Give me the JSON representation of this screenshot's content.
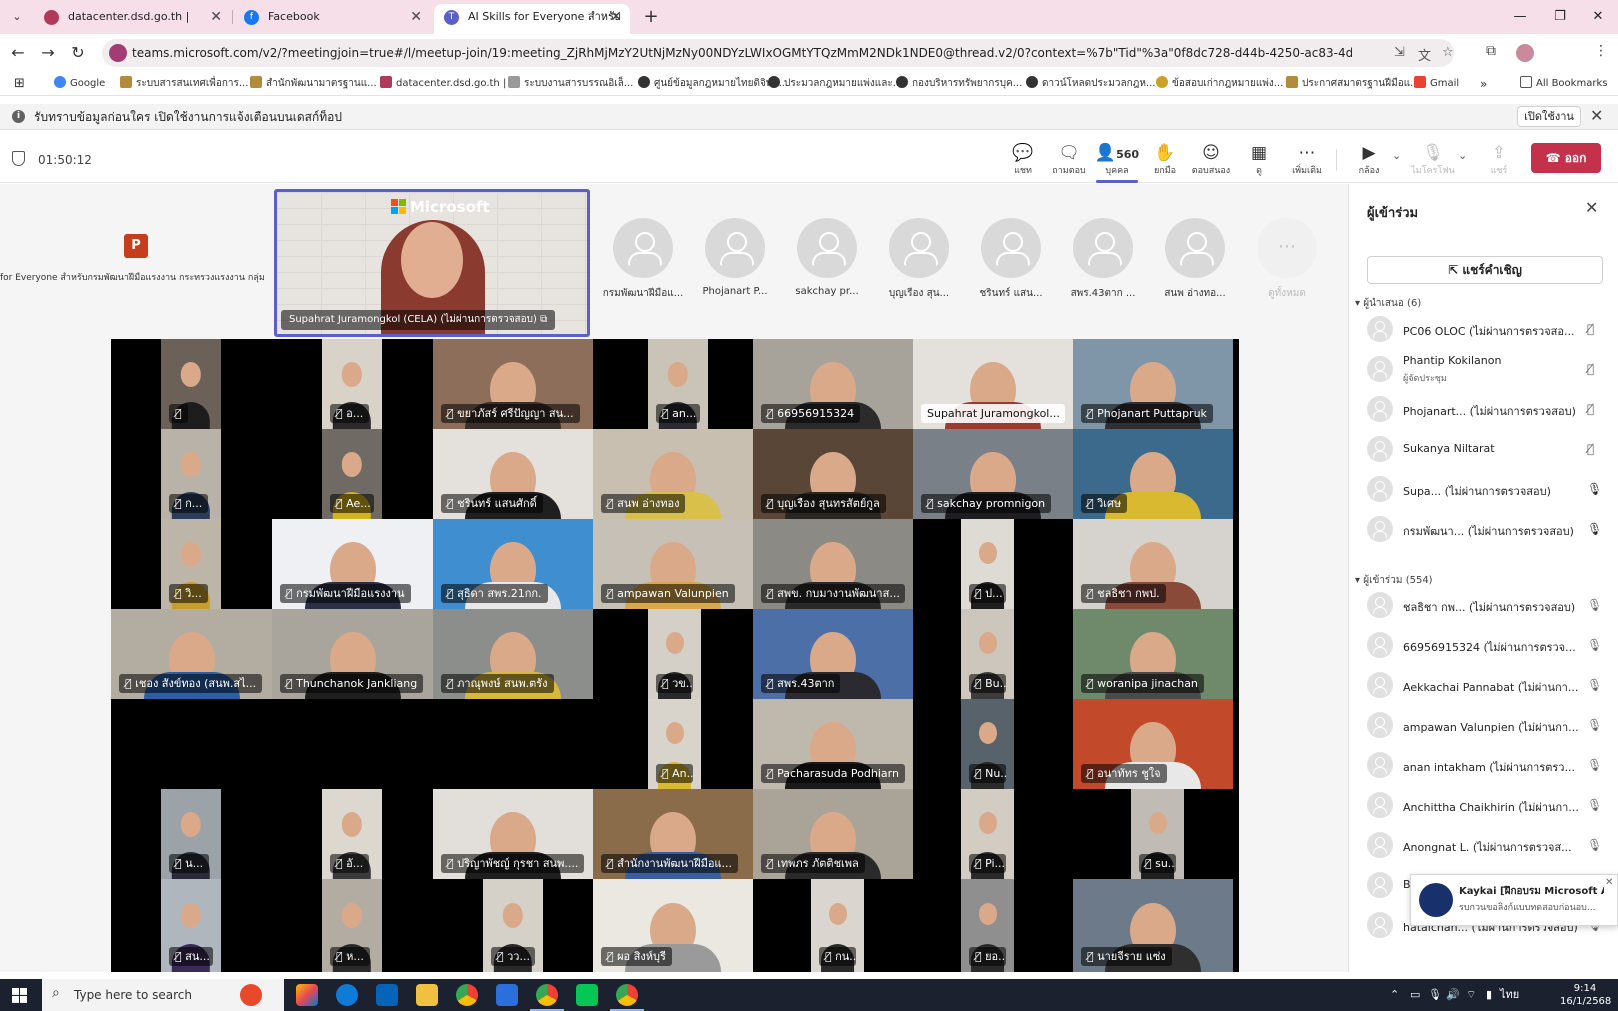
{
  "browser": {
    "tabs": [
      {
        "title": "datacenter.dsd.go.th |",
        "fav_color": "#b03a5b",
        "active": false
      },
      {
        "title": "Facebook",
        "fav_color": "#1877f2",
        "active": false
      },
      {
        "title": "AI Skills for Everyone สำหรับ",
        "fav_color": "#5b5fc7",
        "active": true
      }
    ],
    "new_tab": "+",
    "url": "teams.microsoft.com/v2/?meetingjoin=true#/l/meetup-join/19:meeting_ZjRhMjMzY2UtNjMzNy00NDYzLWIxOGMtYTQzMmM2NDk1NDE0@thread.v2/0?context=%7b\"Tid\"%3a\"0f8dc728-d44b-4250-ac83-4dfe317d4250\"%2c\"Oid\"%3a\"92b...",
    "bookmarks": [
      {
        "label": "Google",
        "color": "#4285f4"
      },
      {
        "label": "ระบบสารสนเทศเพื่อการ...",
        "color": "#b38b3c"
      },
      {
        "label": "สำนักพัฒนามาตรฐานแ...",
        "color": "#b38b3c"
      },
      {
        "label": "datacenter.dsd.go.th |",
        "color": "#b03a5b"
      },
      {
        "label": "ระบบงานสารบรรณอิเล็...",
        "color": "#9a9a9a"
      },
      {
        "label": "ศูนย์ข้อมูลกฎหมายไทยดิจิทัล...",
        "color": "#333333"
      },
      {
        "label": "ประมวลกฎหมายแพ่งและ...",
        "color": "#333333"
      },
      {
        "label": "กองบริหารทรัพยากรบุค...",
        "color": "#333333"
      },
      {
        "label": "ดาวน์โหลดประมวลกฎห...",
        "color": "#333333"
      },
      {
        "label": "ข้อสอบเก่ากฎหมายแพ่ง...",
        "color": "#c9a227"
      },
      {
        "label": "ประกาศสมาตรฐานฝีมือแ...",
        "color": "#b38b3c"
      },
      {
        "label": "Gmail",
        "color": "#ea4335"
      }
    ],
    "all_bookmarks": "All Bookmarks"
  },
  "infobar": {
    "text": "รับทราบข้อมูลก่อนใคร เปิดใช้งานการแจ้งเตือนบนเดสก์ท็อป",
    "enable_button": "เปิดใช้งาน"
  },
  "meeting": {
    "timer": "01:50:12",
    "controls": {
      "chat": "แชท",
      "qa": "ถามตอบ",
      "people": "บุคคล",
      "people_count": "560",
      "raise": "ยกมือ",
      "react": "ตอบสนอง",
      "view": "ดู",
      "more": "เพิ่มเติม",
      "camera": "กล้อง",
      "mic": "ไมโครโฟน",
      "share": "แชร์",
      "leave": "ออก"
    },
    "share_title": "for Everyone สำหรับกรมพัฒนาฝีมือแรงงาน กระทรวงแรงงาน กลุ่ม",
    "ppt_glyph": "P",
    "spotlight_brand": "Microsoft",
    "spotlight_name": "Supahrat Juramongkol (CELA) (ไม่ผ่านการตรวจสอบ)",
    "top_row": [
      "กรมพัฒนาฝีมือแ...",
      "Phojanart P...",
      "sakchay pr...",
      "บุญเรือง สุน...",
      "ชรินทร์ แสน...",
      "สพร.43ตาก ...",
      "สนพ อ่างทอ..."
    ],
    "more_label": "ดูทั้งหมด",
    "tiles": [
      {
        "name": "",
        "bg": "#6b6158",
        "torso": "#1d1d1d"
      },
      {
        "name": "อ...",
        "bg": "#d8d2c8",
        "torso": "#2a2a2a"
      },
      {
        "name": "ขยาภัสร์ ศรีปัญญา สน...",
        "bg": "#8d6e5a",
        "torso": "#3a2f2a"
      },
      {
        "name": "an...",
        "bg": "#c9c3b8",
        "torso": "#2a2a30"
      },
      {
        "name": "66956915324",
        "bg": "#a8a39a",
        "torso": "#2b2b2b"
      },
      {
        "name": "Supahrat Juramongkol...",
        "bg": "#e4e0db",
        "torso": "#9a3b2d"
      },
      {
        "name": "Phojanart Puttapruk",
        "bg": "#7f95a8",
        "torso": "#2f2f35"
      },
      {
        "name": "ก...",
        "bg": "#b8b2a8",
        "torso": "#2b3b5a"
      },
      {
        "name": "Ae...",
        "bg": "#6f6a63",
        "torso": "#d2b21f"
      },
      {
        "name": "ชรินทร์ แสนศักดิ์",
        "bg": "#e4e1dc",
        "torso": "#1f1f1f"
      },
      {
        "name": "สนพ อ่างทอง",
        "bg": "#c9bfb0",
        "torso": "#d8c04a"
      },
      {
        "name": "บุญเรือง สุนทรสัตย์กูล",
        "bg": "#5a4636",
        "torso": "#2a2622"
      },
      {
        "name": "sakchay promnigon",
        "bg": "#7a8087",
        "torso": "#1d1d22"
      },
      {
        "name": "วิเศษ",
        "bg": "#3c6a8c",
        "torso": "#d9b930"
      },
      {
        "name": "วิ...",
        "bg": "#bdb6a8",
        "torso": "#c89d2a"
      },
      {
        "name": "กรมพัฒนาฝีมือแรงงาน",
        "bg": "#eef0f4",
        "torso": "#2a2f45"
      },
      {
        "name": "สุธิดา สพร.21กก.",
        "bg": "#3f8fd0",
        "torso": "#e7e7e7"
      },
      {
        "name": "ampawan Valunpien",
        "bg": "#c6c0b6",
        "torso": "#d9a74a"
      },
      {
        "name": "สพข. กบมางานพัฒนาส...",
        "bg": "#8c8a85",
        "torso": "#2a2a2a"
      },
      {
        "name": "ป...",
        "bg": "#dedad4",
        "torso": "#1f1f1f"
      },
      {
        "name": "ชลธิชา กพป.",
        "bg": "#d6d3cf",
        "torso": "#8a4a3a"
      },
      {
        "name": "เชอง สังข์ทอง (สนพ.สไ...",
        "bg": "#b3aca0",
        "torso": "#2b5fa8"
      },
      {
        "name": "Thunchanok Jankliang",
        "bg": "#a9a49c",
        "torso": "#1f1f1f"
      },
      {
        "name": "ภาณุพงษ์ สนพ.ตรัง",
        "bg": "#8b8e8a",
        "torso": "#d8b83a"
      },
      {
        "name": "วข...",
        "bg": "#d4cfc7",
        "torso": "#2a2a2a"
      },
      {
        "name": "สพร.43ตาก",
        "bg": "#4d6fa8",
        "torso": "#2a2a30"
      },
      {
        "name": "Bu...",
        "bg": "#ccc6bd",
        "torso": "#3b3b3b"
      },
      {
        "name": "woranipa jinachan",
        "bg": "#6f8a6a",
        "torso": "#4a4a4a"
      },
      {
        "name": "An...",
        "bg": "#d8d4cc",
        "torso": "#d9b930"
      },
      {
        "name": "Pacharasuda Podhiarn",
        "bg": "#bfb8ad",
        "torso": "#1a1a1a"
      },
      {
        "name": "Nu...",
        "bg": "#58626a",
        "torso": "#2a2a2a"
      },
      {
        "name": "อนาทัทร ชูใจ",
        "bg": "#c24a2a",
        "torso": "#e8e8e8"
      },
      {
        "name": "น...",
        "bg": "#9ca3a8",
        "torso": "#2a2a3a"
      },
      {
        "name": "อั...",
        "bg": "#dcd8d0",
        "torso": "#3a3a3a"
      },
      {
        "name": "ปริญาพัชญ์ กุรชา สนพ....",
        "bg": "#e2dfda",
        "torso": "#1f1f1f"
      },
      {
        "name": "สำนักงานพัฒนาฝีมือแ...",
        "bg": "#8a6b4a",
        "torso": "#3a5fa0"
      },
      {
        "name": "เทพภร ภัตติชเพล",
        "bg": "#a9a398",
        "torso": "#2a2a2a"
      },
      {
        "name": "Pi...",
        "bg": "#d2ccc2",
        "torso": "#2a2a2a"
      },
      {
        "name": "su...",
        "bg": "#c0bcb5",
        "torso": "#1f1f1f"
      },
      {
        "name": "สน...",
        "bg": "#afb6bd",
        "torso": "#3a2a5a"
      },
      {
        "name": "ห...",
        "bg": "#b2aca2",
        "torso": "#2a2a2a"
      },
      {
        "name": "วว...",
        "bg": "#d6d1c8",
        "torso": "#2a2a2a"
      },
      {
        "name": "ผอ สิงห์บุรี",
        "bg": "#ebe7e1",
        "torso": "#9a9a9a"
      },
      {
        "name": "กน...",
        "bg": "#dad6cf",
        "torso": "#2a2a2a"
      },
      {
        "name": "ยอ...",
        "bg": "#8f8f8f",
        "torso": "#2a2a2a"
      },
      {
        "name": "นายจีราย แซ่ง",
        "bg": "#6c7a89",
        "torso": "#2f2f2f"
      }
    ]
  },
  "panel": {
    "title": "ผู้เข้าร่วม",
    "invite": "แชร์คำเชิญ",
    "presenters_header": "ผู้นำเสนอ (6)",
    "attendees_header": "ผู้เข้าร่วม (554)",
    "presenters": [
      {
        "name": "PC06 OLOC (ไม่ผ่านการตรวจสอ...",
        "sub": "",
        "mic": "🎙̸"
      },
      {
        "name": "Phantip Kokilanon",
        "sub": "ผู้จัดประชุม",
        "mic": "🎙̸"
      },
      {
        "name": "Phojanart... (ไม่ผ่านการตรวจสอบ)",
        "sub": "",
        "mic": "🎙̸"
      },
      {
        "name": "Sukanya Niltarat",
        "sub": "",
        "mic": "🎙̸"
      },
      {
        "name": "Supa... (ไม่ผ่านการตรวจสอบ)",
        "sub": "",
        "mic": "🎙"
      },
      {
        "name": "กรมพัฒนา... (ไม่ผ่านการตรวจสอบ)",
        "sub": "",
        "mic": "🎙"
      }
    ],
    "attendees": [
      {
        "name": "ชลธิชา กพ... (ไม่ผ่านการตรวจสอบ)"
      },
      {
        "name": "66956915324 (ไม่ผ่านการตรวจ..."
      },
      {
        "name": "Aekkachai Pannabat (ไม่ผ่านกา..."
      },
      {
        "name": "ampawan Valunpien (ไม่ผ่านกา..."
      },
      {
        "name": "anan intakham (ไม่ผ่านการตรว..."
      },
      {
        "name": "Anchittha Chaikhirin (ไม่ผ่านกา..."
      },
      {
        "name": "Anongnat L. (ไม่ผ่านการตรวจส..."
      },
      {
        "name": "Bu..."
      },
      {
        "name": "hataichan... (ไม่ผ่านการตรวจสอบ)"
      }
    ],
    "toast": {
      "title": "Kaykai [ฝึกอบรม Microsoft AI ...",
      "body": "รบกวนขอลิงก์แบบทดสอบก่อนอบ..."
    }
  },
  "taskbar": {
    "search_placeholder": "Type here to search",
    "lang": "ไทย",
    "time": "9:14",
    "date": "16/1/2568"
  }
}
